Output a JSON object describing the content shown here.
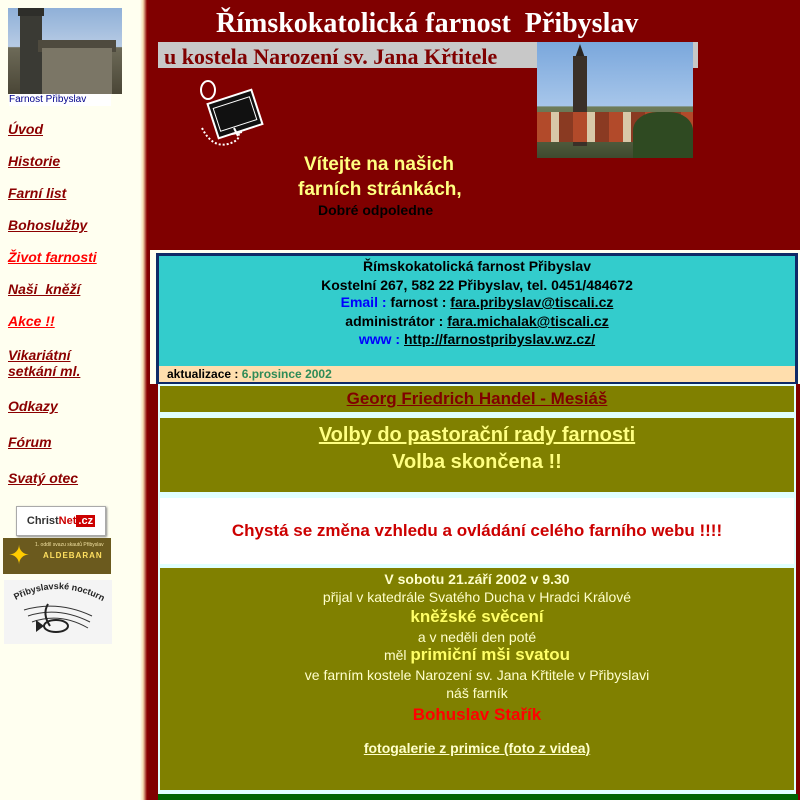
{
  "sidebar": {
    "photo_caption": "Farnost Přibyslav",
    "nav": [
      {
        "label": "Úvod",
        "style": "normal"
      },
      {
        "label": "Historie",
        "style": "normal"
      },
      {
        "label": "Farní list",
        "style": "normal"
      },
      {
        "label": "Bohoslužby",
        "style": "normal"
      },
      {
        "label": "Život farnosti",
        "style": "red"
      },
      {
        "label": "Naši  kněží",
        "style": "normal"
      },
      {
        "label": "Akce !!",
        "style": "red"
      },
      {
        "label_line1": "Vikariátní",
        "label_line2": "setkání ml.",
        "style": "normal"
      },
      {
        "label": "Odkazy",
        "style": "normal"
      },
      {
        "label": "Fórum",
        "style": "normal"
      },
      {
        "label": "Svatý otec",
        "style": "normal"
      }
    ],
    "logos": {
      "christnet": {
        "text_a": "Christ",
        "text_b": "Net",
        "text_c": ".cz"
      },
      "alde": {
        "line1": "1. oddíl svazu skautů Přibyslav",
        "line2": "ALDEBARAN"
      },
      "nocturno": {
        "text": "Přibyslavské nocturno"
      }
    }
  },
  "header": {
    "title": "Římskokatolická farnost  Přibyslav",
    "subtitle": "u kostela Narození sv. Jana Křtitele",
    "welcome_line1": "Vítejte na našich",
    "welcome_line2": "farních stránkách,",
    "greeting": "Dobré odpoledne"
  },
  "contact": {
    "name": "Římskokatolická farnost Přibyslav",
    "address": "Kostelní 267, 582 22 Přibyslav, tel. 0451/484672",
    "email_label": "Email :",
    "email_who": " farnost : ",
    "email_addr": "fara.pribyslav@tiscali.cz",
    "admin_who": "administrátor : ",
    "admin_addr": "fara.michalak@tiscali.cz",
    "www_label": "www :",
    "www_addr": "http://farnostpribyslav.wz.cz/"
  },
  "update": {
    "label": "aktualizace :",
    "value": " 6.prosince 2002"
  },
  "content": {
    "handel_link": "Georg Friedrich Handel - Mesiáš",
    "volby_link": "Volby do pastorační rady farnosti",
    "volby_status": "Volba skončena !!",
    "change_notice": "Chystá se změna vzhledu a ovládání celého farního webu !!!!",
    "ordination": {
      "line1": "V sobotu 21.září 2002 v 9.30",
      "line2": "přijal v katedrále Svatého Ducha v Hradci Králové",
      "line3": "kněžské svěcení",
      "line4": "a v neděli den poté",
      "line5_a": "měl ",
      "line5_b": "primiční mši svatou",
      "line6": "ve farním kostele Narození sv. Jana Křtitele v Přibyslavi",
      "line7": "náš farník",
      "name": "Bohuslav Stařík",
      "gallery_link": "fotogalerie z primice (foto z videa)"
    }
  },
  "colors": {
    "maroon": "#800000",
    "olive": "#808000",
    "cyan": "#33cccc",
    "link_red": "#8b0000",
    "welcome_yellow": "#ffff80"
  }
}
